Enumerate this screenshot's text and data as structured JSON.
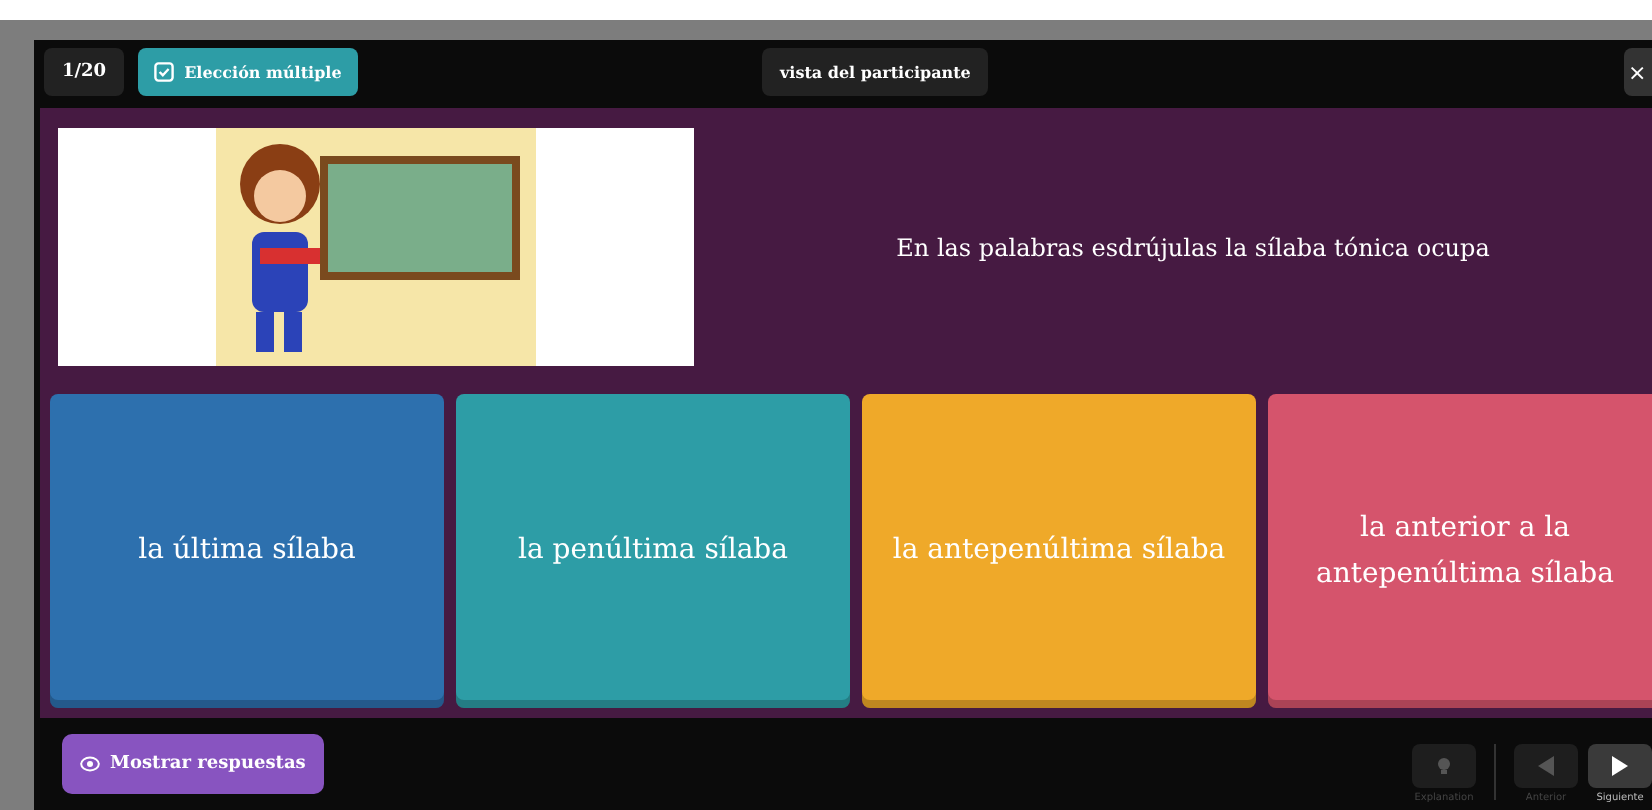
{
  "header": {
    "counter": "1/20",
    "question_type": "Elección múltiple",
    "view_label": "vista del participante",
    "close": "×"
  },
  "question": {
    "text": "En las palabras esdrújulas la sílaba tónica ocupa"
  },
  "options": [
    {
      "text": "la última sílaba",
      "color": "#2d70ae"
    },
    {
      "text": "la penúltima sílaba",
      "color": "#2d9da6"
    },
    {
      "text": "la antepenúltima sílaba",
      "color": "#efa929"
    },
    {
      "text": "la anterior a la antepenúltima sílaba",
      "color": "#d5546c"
    }
  ],
  "footer": {
    "show_answers": "Mostrar respuestas",
    "controls": [
      {
        "kind": "explanation",
        "label": "Explanation",
        "disabled": true
      },
      {
        "kind": "previous",
        "label": "Anterior",
        "disabled": true
      },
      {
        "kind": "next",
        "label": "Siguiente",
        "disabled": false
      }
    ]
  }
}
